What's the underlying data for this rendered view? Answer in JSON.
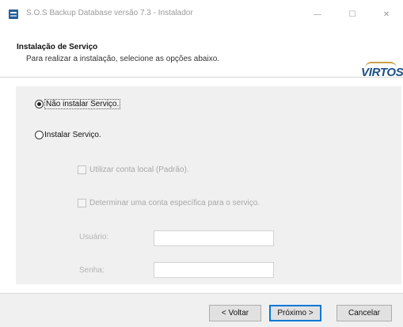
{
  "window": {
    "title": "S.O.S Backup Database versão 7.3 - Instalador",
    "controls": {
      "minimize": "—",
      "maximize": "☐",
      "close": "✕"
    },
    "icon": "app-icon"
  },
  "header": {
    "title": "Instalação de Serviço",
    "subtitle": "Para realizar a instalação, selecione as opções abaixo.",
    "logo": "VIRTOS"
  },
  "options": {
    "no_install": {
      "label": "Não instalar Serviço.",
      "selected": true
    },
    "install": {
      "label": "Instalar Serviço.",
      "selected": false
    },
    "local_account": {
      "label": "Utilizar conta local (Padrão).",
      "checked": false,
      "enabled": false
    },
    "specific_account": {
      "label": "Determinar uma conta específica para o serviço.",
      "checked": false,
      "enabled": false
    }
  },
  "fields": {
    "user": {
      "label": "Usuário:",
      "value": ""
    },
    "password": {
      "label": "Senha:",
      "value": ""
    }
  },
  "buttons": {
    "back": "< Voltar",
    "next": "Próximo >",
    "cancel": "Cancelar"
  },
  "colors": {
    "accent": "#0078d7",
    "logo": "#1b4f86",
    "panel": "#f0f0f0"
  }
}
